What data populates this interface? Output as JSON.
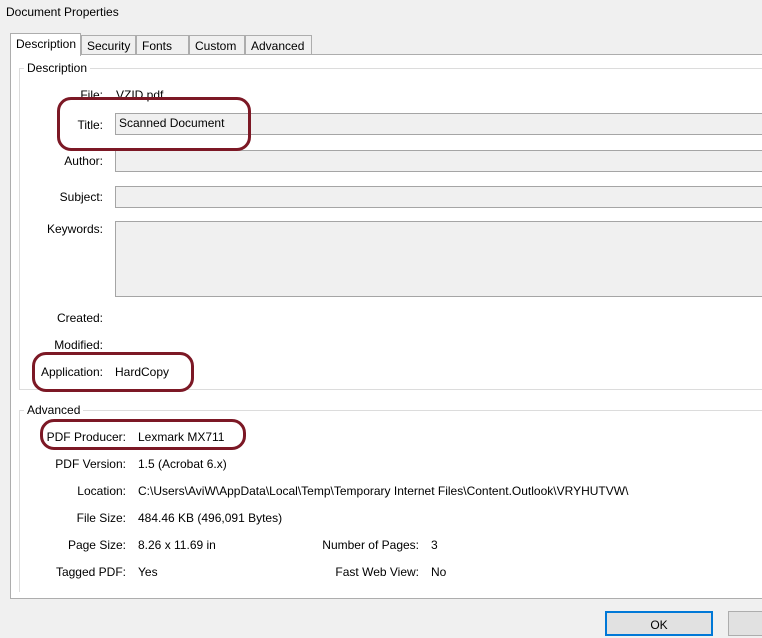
{
  "window": {
    "title": "Document Properties"
  },
  "tabs": [
    {
      "label": "Description",
      "active": true
    },
    {
      "label": "Security",
      "active": false
    },
    {
      "label": "Fonts",
      "active": false
    },
    {
      "label": "Custom",
      "active": false
    },
    {
      "label": "Advanced",
      "active": false
    }
  ],
  "description": {
    "group_label": "Description",
    "file_label": "File:",
    "file_value": "VZID.pdf",
    "title_label": "Title:",
    "title_value": "Scanned Document",
    "author_label": "Author:",
    "author_value": "",
    "subject_label": "Subject:",
    "subject_value": "",
    "keywords_label": "Keywords:",
    "keywords_value": "",
    "created_label": "Created:",
    "created_value": "",
    "modified_label": "Modified:",
    "modified_value": "",
    "application_label": "Application:",
    "application_value": "HardCopy"
  },
  "advanced": {
    "group_label": "Advanced",
    "producer_label": "PDF Producer:",
    "producer_value": "Lexmark MX711",
    "version_label": "PDF Version:",
    "version_value": "1.5 (Acrobat 6.x)",
    "location_label": "Location:",
    "location_value": "C:\\Users\\AviW\\AppData\\Local\\Temp\\Temporary Internet Files\\Content.Outlook\\VRYHUTVW\\",
    "filesize_label": "File Size:",
    "filesize_value": "484.46 KB (496,091 Bytes)",
    "pagesize_label": "Page Size:",
    "pagesize_value": "8.26 x 11.69 in",
    "numpages_label": "Number of Pages:",
    "numpages_value": "3",
    "tagged_label": "Tagged PDF:",
    "tagged_value": "Yes",
    "fastweb_label": "Fast Web View:",
    "fastweb_value": "No"
  },
  "buttons": {
    "ok_label": "OK",
    "cancel_label": ""
  },
  "colors": {
    "highlight": "#7c1825",
    "field_bg": "#f0f0f0",
    "focus": "#0078d7"
  }
}
